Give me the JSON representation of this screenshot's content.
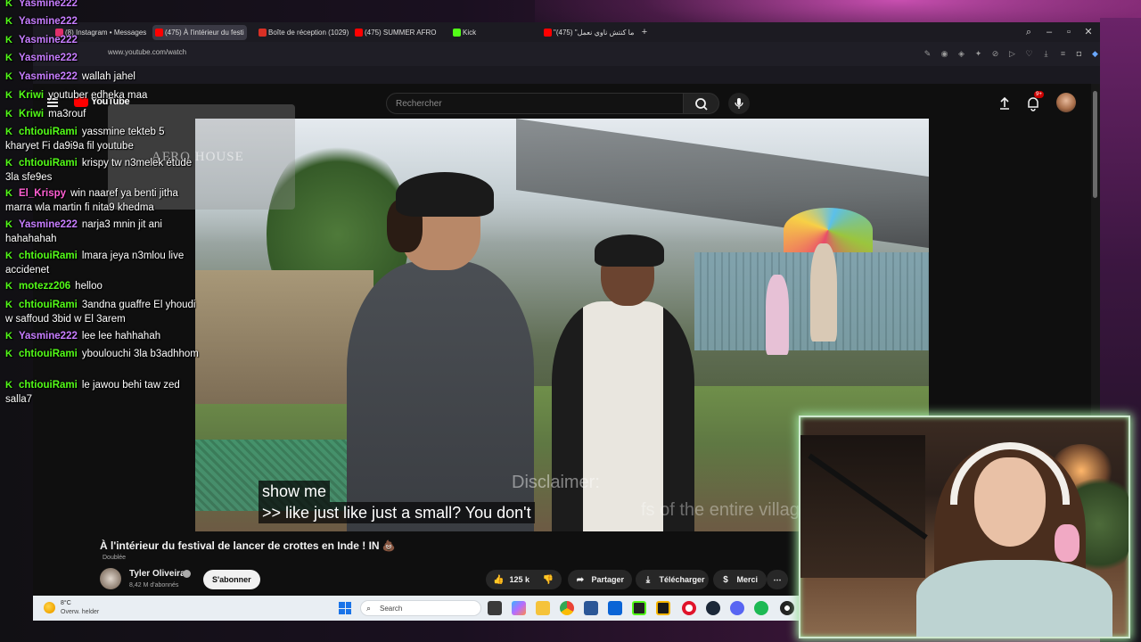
{
  "browser": {
    "tabs": [
      {
        "label": "(8) Instagram • Messages",
        "icon_color": "#e1306c"
      },
      {
        "label": "(475) À l'intérieur du festi",
        "icon_color": "#ff0000",
        "active": true
      },
      {
        "label": "Boîte de réception (1029)",
        "icon_color": "#d93025"
      },
      {
        "label": "(475) SUMMER AFRO",
        "icon_color": "#ff0000"
      },
      {
        "label": "Kick",
        "icon_color": "#53fc18"
      },
      {
        "label": "\"ما كنتش ناوي نعمل\" (475)",
        "icon_color": "#ff0000"
      }
    ],
    "new_tab_icon": "plus-icon",
    "url": "www.youtube.com/watch"
  },
  "youtube": {
    "logo_text": "YouTube",
    "search_placeholder": "Rechercher",
    "notif_badge": "9+",
    "video": {
      "captions": [
        "show me",
        ">> like just like just a small? You don't"
      ],
      "disclaimer": "Disclaimer:",
      "disclaimer2": "fs of the entire village",
      "title": "À l'intérieur du festival de lancer de crottes en Inde ! IN 💩",
      "dubbed": "Doublée",
      "channel": "Tyler Oliveira",
      "subscribers": "8,42 M d'abonnés",
      "subscribe_label": "S'abonner",
      "likes": "125 k",
      "share_label": "Partager",
      "download_label": "Télécharger",
      "thanks_label": "Merci"
    }
  },
  "taskbar": {
    "weather_temp": "8°C",
    "weather_desc": "Overw. helder",
    "search_label": "Search"
  },
  "chat": {
    "brand_color": "#53fc18",
    "messages": [
      {
        "user": "Yasmine222",
        "color": "#c77dff",
        "text": ""
      },
      {
        "user": "Yasmine222",
        "color": "#c77dff",
        "text": ""
      },
      {
        "user": "Yasmine222",
        "color": "#c77dff",
        "text": ""
      },
      {
        "user": "Yasmine222",
        "color": "#c77dff",
        "text": ""
      },
      {
        "user": "Yasmine222",
        "color": "#c77dff",
        "text": "wallah jahel"
      },
      {
        "user": "Kriwi",
        "color": "#53fc18",
        "text": "youtuber edheka maa"
      },
      {
        "user": "Kriwi",
        "color": "#53fc18",
        "text": "ma3rouf"
      },
      {
        "user": "chtiouiRami",
        "color": "#53fc18",
        "text": "yassmine tekteb 5 kharyet Fi da9i9a fil youtube"
      },
      {
        "user": "chtiouiRami",
        "color": "#53fc18",
        "text": "krispy tw n3melek étude 3la sfe9es"
      },
      {
        "user": "El_Krispy",
        "color": "#ff5fd2",
        "text": "win naaref ya benti jitha marra wla martin fi nita9 khedma"
      },
      {
        "user": "Yasmine222",
        "color": "#c77dff",
        "text": "narja3 mnin jit ani hahahahah"
      },
      {
        "user": "chtiouiRami",
        "color": "#53fc18",
        "text": "lmara jeya n3mlou live accidenet"
      },
      {
        "user": "motezz206",
        "color": "#53fc18",
        "text": "helloo"
      },
      {
        "user": "chtiouiRami",
        "color": "#53fc18",
        "text": "3andna guaffre El yhoudi w saffoud 3bid w El 3arem"
      },
      {
        "user": "Yasmine222",
        "color": "#c77dff",
        "text": "lee lee hahhahah"
      },
      {
        "user": "chtiouiRami",
        "color": "#53fc18",
        "text": "yboulouchi 3la b3adhhom"
      },
      {
        "user": "chtiouiRami",
        "color": "#53fc18",
        "text": "le jawou behi taw zed salla7"
      }
    ]
  },
  "overlay": {
    "afro_label": "AFRO HOUSE"
  }
}
